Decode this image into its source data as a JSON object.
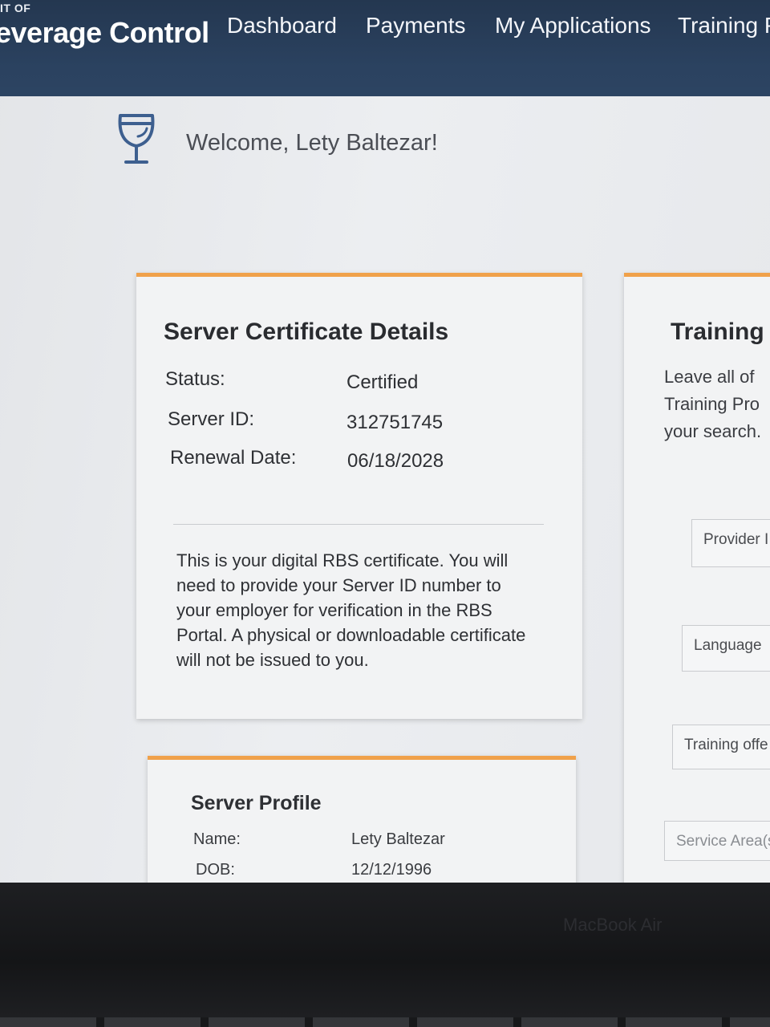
{
  "header": {
    "agency_prefix": "IT OF",
    "agency_name": "everage Control",
    "nav": [
      "Dashboard",
      "Payments",
      "My Applications",
      "Training P"
    ]
  },
  "welcome": {
    "icon": "wine-glass-icon",
    "text": "Welcome, Lety Baltezar!"
  },
  "certificate": {
    "title": "Server Certificate Details",
    "status_label": "Status:",
    "status_value": "Certified",
    "server_id_label": "Server ID:",
    "server_id_value": "312751745",
    "renewal_label": "Renewal Date:",
    "renewal_value": "06/18/2028",
    "note": "This is your digital RBS certificate. You will need to provide your Server ID number to your employer for verification in the RBS Portal. A physical or downloadable certificate will not be issued to you."
  },
  "profile": {
    "title": "Server Profile",
    "name_label": "Name:",
    "name_value": "Lety Baltezar",
    "dob_label": "DOB:",
    "dob_value": "12/12/1996"
  },
  "training": {
    "title": "Training",
    "desc_lines": [
      "Leave all of",
      "Training Pro",
      "your search."
    ],
    "filters": [
      "Provider I",
      "Language",
      "Training offe",
      "Service Area(s)"
    ]
  },
  "device": {
    "brand": "MacBook Air"
  },
  "colors": {
    "navbar": "#2b4260",
    "card_accent": "#f0a14a",
    "icon": "#3d5f8f"
  }
}
